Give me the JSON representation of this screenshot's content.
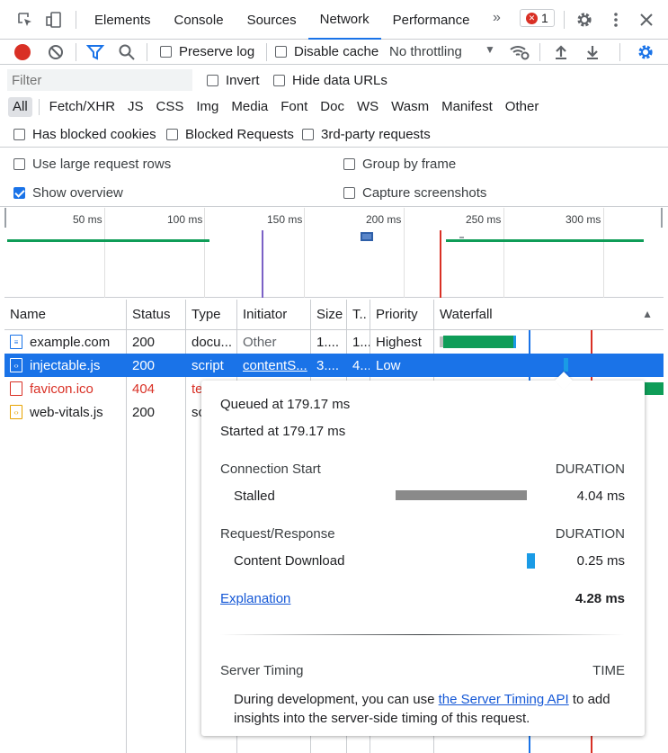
{
  "tabs": {
    "items": [
      "Elements",
      "Console",
      "Sources",
      "Network",
      "Performance"
    ],
    "active": "Network",
    "error_count": "1"
  },
  "toolbar": {
    "preserve_log": "Preserve log",
    "disable_cache": "Disable cache",
    "throttling": "No throttling"
  },
  "filter": {
    "placeholder": "Filter",
    "invert": "Invert",
    "hide_data_urls": "Hide data URLs"
  },
  "types": [
    "All",
    "Fetch/XHR",
    "JS",
    "CSS",
    "Img",
    "Media",
    "Font",
    "Doc",
    "WS",
    "Wasm",
    "Manifest",
    "Other"
  ],
  "blocked": {
    "has_blocked_cookies": "Has blocked cookies",
    "blocked_requests": "Blocked Requests",
    "third_party": "3rd-party requests"
  },
  "settings": {
    "large_rows": "Use large request rows",
    "group_by_frame": "Group by frame",
    "show_overview": "Show overview",
    "capture_screenshots": "Capture screenshots"
  },
  "overview": {
    "ticks": [
      "50 ms",
      "100 ms",
      "150 ms",
      "200 ms",
      "250 ms",
      "300 ms"
    ]
  },
  "table": {
    "headers": [
      "Name",
      "Status",
      "Type",
      "Initiator",
      "Size",
      "T..",
      "Priority",
      "Waterfall"
    ],
    "rows": [
      {
        "name": "example.com",
        "status": "200",
        "type": "docu...",
        "initiator": "Other",
        "size": "1....",
        "time": "1...",
        "priority": "Highest"
      },
      {
        "name": "injectable.js",
        "status": "200",
        "type": "script",
        "initiator": "contentS...",
        "size": "3....",
        "time": "4...",
        "priority": "Low"
      },
      {
        "name": "favicon.ico",
        "status": "404",
        "type": "te",
        "initiator": "",
        "size": "",
        "time": "",
        "priority": ""
      },
      {
        "name": "web-vitals.js",
        "status": "200",
        "type": "sc",
        "initiator": "",
        "size": "",
        "time": "",
        "priority": ""
      }
    ]
  },
  "tooltip": {
    "queued": "Queued at 179.17 ms",
    "started": "Started at 179.17 ms",
    "connection_start": "Connection Start",
    "duration": "DURATION",
    "stalled": "Stalled",
    "stalled_value": "4.04 ms",
    "request_response": "Request/Response",
    "content_download": "Content Download",
    "content_download_value": "0.25 ms",
    "explanation": "Explanation",
    "total": "4.28 ms",
    "server_timing": "Server Timing",
    "time": "TIME",
    "server_text_1": "During development, you can use ",
    "server_link": "the Server Timing API",
    "server_text_2": " to add",
    "server_text_3": "insights into the server-side timing of this request."
  },
  "colors": {
    "accent": "#1a73e8",
    "error": "#d93025",
    "waterfall_green": "#0f9d58",
    "stalled_gray": "#8a8a8a",
    "download_blue": "#1a9be6"
  }
}
